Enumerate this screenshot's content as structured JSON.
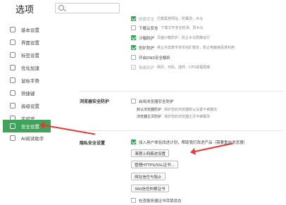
{
  "app_title": "选项",
  "sidebar": {
    "items": [
      {
        "label": "基本设置"
      },
      {
        "label": "界面设置"
      },
      {
        "label": "标签设置"
      },
      {
        "label": "优化加速"
      },
      {
        "label": "鼠标手势"
      },
      {
        "label": "快捷键"
      },
      {
        "label": "高级设置"
      },
      {
        "label": "实验室"
      },
      {
        "label": "安全设置",
        "active": true
      },
      {
        "label": "AI阅读助手"
      }
    ]
  },
  "top_checks": [
    {
      "label": "网盾安全",
      "desc": "拦截恶意网址，防篡改，木马",
      "checked": true,
      "faint": true
    },
    {
      "label": "下载云安全",
      "desc": "下载文件安全检测，防木马",
      "checked": false
    },
    {
      "label": "沙箱防护",
      "desc": "页面沙箱防护，防止木马隐蔽运行",
      "checked": true
    },
    {
      "label": "挖矿防护",
      "desc": "禁止共享数字货币挖矿脚本，防止电脑被恶意利用",
      "checked": true
    },
    {
      "label": "开启DNS安全解析",
      "desc": "",
      "checked": false
    },
    {
      "label": "隔离防护",
      "desc": "网页、代码、插件、CPU进程隔离",
      "checked": false,
      "disabled": true
    }
  ],
  "browser_protection": {
    "section_label": "浏览器安全防护",
    "check_label": "启用浏览器安全防护",
    "sub_items": [
      {
        "label": "默认浏览器防护",
        "desc": "保护您的浏览器默认设置不被篡改"
      },
      {
        "label": "浏览器主页防护",
        "desc": "保护您的浏览器主页不被篡改"
      }
    ]
  },
  "privacy": {
    "section_label": "隐私安全设置",
    "check_label": "加入用户体验改进计划，帮助我们改进产品（需要重启浏览器）",
    "buttons": {
      "clear": "清理上网痕迹设置",
      "cert": "管理HTTPS/SSL证书...",
      "fraud": "网址信任与阻止",
      "trusted_cert": "360信任的根证书"
    },
    "last_check_label": "检查服务器证书吊销状态"
  },
  "colors": {
    "accent": "#3fa35b",
    "arrow": "#e53935"
  }
}
